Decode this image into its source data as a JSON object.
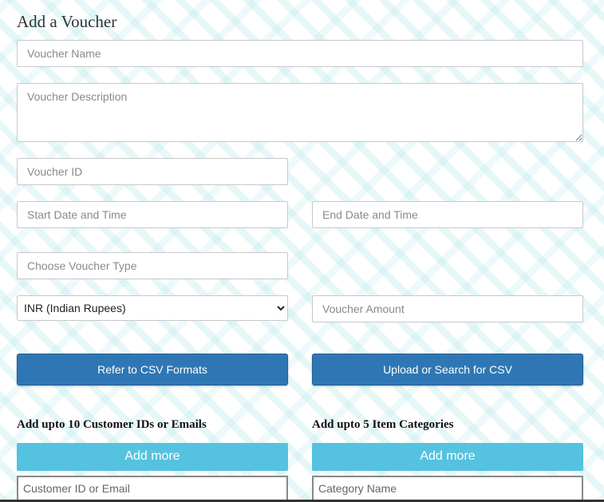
{
  "form": {
    "title": "Add a Voucher",
    "voucher_name_placeholder": "Voucher Name",
    "voucher_description_placeholder": "Voucher Description",
    "voucher_id_placeholder": "Voucher ID",
    "start_date_placeholder": "Start Date and Time",
    "end_date_placeholder": "End Date and Time",
    "voucher_type_placeholder": "Choose Voucher Type",
    "currency_selected": "INR (Indian Rupees)",
    "voucher_amount_placeholder": "Voucher Amount",
    "csv_formats_button": "Refer to CSV Formats",
    "upload_csv_button": "Upload or Search for CSV"
  },
  "customers": {
    "heading": "Add upto 10 Customer IDs or Emails",
    "add_more_label": "Add more",
    "input_placeholder": "Customer ID or Email"
  },
  "categories": {
    "heading": "Add upto 5 Item Categories",
    "add_more_label": "Add more",
    "input_placeholder": "Category Name"
  },
  "colors": {
    "primary_button": "#2f77b4",
    "add_more_button": "#55c2e0",
    "pattern": "#beeaec"
  }
}
